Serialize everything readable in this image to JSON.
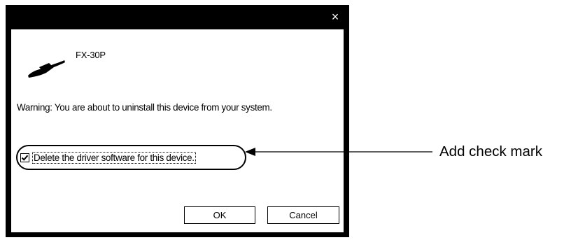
{
  "dialog": {
    "close_glyph": "×",
    "device_icon": "device-plug-icon",
    "device_name": "FX-30P",
    "warning_text": "Warning: You are about to uninstall this device from your system.",
    "checkbox": {
      "label": "Delete the driver software for this device.",
      "checked": true
    },
    "buttons": {
      "ok_label": "OK",
      "cancel_label": "Cancel"
    }
  },
  "annotation": {
    "callout_text": "Add check mark"
  },
  "colors": {
    "frame": "#000000",
    "client_background": "#ffffff",
    "title_glyph": "#ffffff"
  }
}
